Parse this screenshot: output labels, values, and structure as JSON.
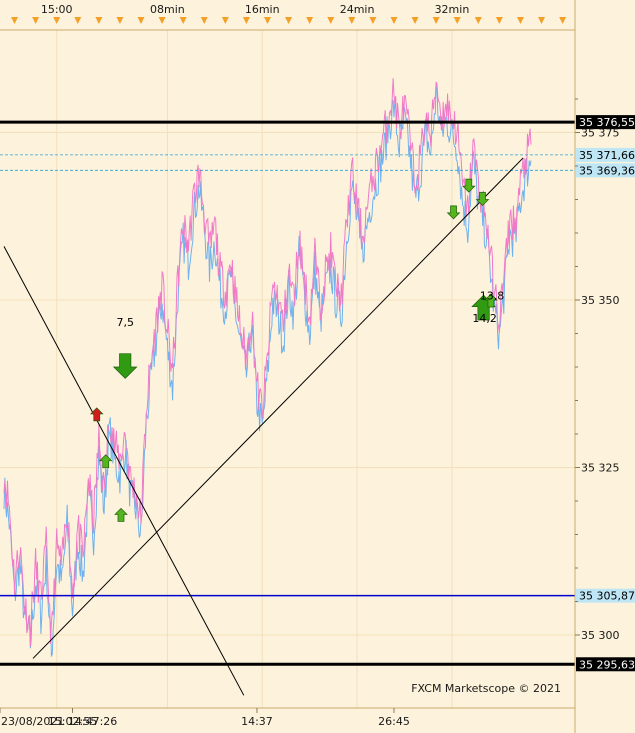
{
  "chart_data": {
    "type": "line",
    "price_axis": {
      "ticks": [
        {
          "value": 35375,
          "label": "35 375"
        },
        {
          "value": 35350,
          "label": "35 350"
        },
        {
          "value": 35325,
          "label": "35 325"
        },
        {
          "value": 35300,
          "label": "35 300"
        }
      ]
    },
    "top_time_ticks": [
      {
        "label": "15:00",
        "x": 10
      },
      {
        "label": "08min",
        "x": 31
      },
      {
        "label": "16min",
        "x": 49
      },
      {
        "label": "24min",
        "x": 67
      },
      {
        "label": "32min",
        "x": 85
      }
    ],
    "bottom_time_ticks": [
      {
        "label": "23/08/2021 14:47:26",
        "x": 0
      },
      {
        "label": "15:02:55",
        "x": 13
      },
      {
        "label": "14:37",
        "x": 48
      },
      {
        "label": "26:45",
        "x": 74
      }
    ],
    "x_range": [
      0,
      100
    ],
    "price_series": [
      [
        0,
        35323
      ],
      [
        1,
        35318
      ],
      [
        2,
        35307
      ],
      [
        3,
        35312
      ],
      [
        4,
        35303
      ],
      [
        5,
        35300
      ],
      [
        6,
        35309
      ],
      [
        7,
        35304
      ],
      [
        8,
        35312
      ],
      [
        9,
        35298
      ],
      [
        10,
        35312
      ],
      [
        11,
        35309
      ],
      [
        12,
        35318
      ],
      [
        13,
        35305
      ],
      [
        14,
        35315
      ],
      [
        15,
        35310
      ],
      [
        16,
        35322
      ],
      [
        17,
        35316
      ],
      [
        18,
        35328
      ],
      [
        19,
        35320
      ],
      [
        20,
        35332
      ],
      [
        21,
        35327
      ],
      [
        22,
        35325
      ],
      [
        23,
        35329
      ],
      [
        24,
        35322
      ],
      [
        25,
        35320
      ],
      [
        26,
        35316
      ],
      [
        27,
        35333
      ],
      [
        28,
        35340
      ],
      [
        29,
        35346
      ],
      [
        30,
        35351
      ],
      [
        31,
        35344
      ],
      [
        32,
        35338
      ],
      [
        33,
        35352
      ],
      [
        34,
        35360
      ],
      [
        35,
        35357
      ],
      [
        36,
        35364
      ],
      [
        37,
        35368
      ],
      [
        38,
        35362
      ],
      [
        39,
        35356
      ],
      [
        40,
        35360
      ],
      [
        41,
        35353
      ],
      [
        42,
        35350
      ],
      [
        43,
        35355
      ],
      [
        44,
        35349
      ],
      [
        45,
        35344
      ],
      [
        46,
        35340
      ],
      [
        47,
        35347
      ],
      [
        48,
        35336
      ],
      [
        49,
        35332
      ],
      [
        50,
        35340
      ],
      [
        51,
        35351
      ],
      [
        52,
        35349
      ],
      [
        53,
        35345
      ],
      [
        54,
        35353
      ],
      [
        55,
        35349
      ],
      [
        56,
        35358
      ],
      [
        57,
        35352
      ],
      [
        58,
        35346
      ],
      [
        59,
        35356
      ],
      [
        60,
        35348
      ],
      [
        61,
        35353
      ],
      [
        62,
        35356
      ],
      [
        63,
        35351
      ],
      [
        64,
        35349
      ],
      [
        65,
        35360
      ],
      [
        66,
        35368
      ],
      [
        67,
        35363
      ],
      [
        68,
        35358
      ],
      [
        69,
        35363
      ],
      [
        70,
        35367
      ],
      [
        71,
        35370
      ],
      [
        72,
        35373
      ],
      [
        73,
        35377
      ],
      [
        74,
        35380
      ],
      [
        75,
        35374
      ],
      [
        76,
        35378
      ],
      [
        77,
        35373
      ],
      [
        78,
        35366
      ],
      [
        79,
        35370
      ],
      [
        80,
        35376
      ],
      [
        81,
        35373
      ],
      [
        82,
        35382
      ],
      [
        83,
        35376
      ],
      [
        84,
        35378
      ],
      [
        85,
        35376
      ],
      [
        86,
        35374
      ],
      [
        87,
        35366
      ],
      [
        88,
        35362
      ],
      [
        89,
        35372
      ],
      [
        90,
        35366
      ],
      [
        91,
        35363
      ],
      [
        92,
        35358
      ],
      [
        93,
        35350
      ],
      [
        94,
        35346
      ],
      [
        95,
        35353
      ],
      [
        96,
        35361
      ],
      [
        97,
        35360
      ],
      [
        98,
        35366
      ],
      [
        99,
        35370
      ],
      [
        100,
        35372
      ]
    ],
    "horizontal_lines": [
      {
        "name": "black-upper",
        "value": 35376.55,
        "tag": "35 376,55",
        "color": "#000000",
        "tag_bg": "#000000",
        "tag_fg": "#ffffff"
      },
      {
        "name": "cyan-upper",
        "value": 35371.66,
        "tag": "35 371,66",
        "color": "#2f9ed8",
        "tag_bg": "#bfe6f5",
        "tag_fg": "#000000"
      },
      {
        "name": "cyan-lower",
        "value": 35369.36,
        "tag": "35 369,36",
        "color": "#2f9ed8",
        "tag_bg": "#bfe6f5",
        "tag_fg": "#000000"
      },
      {
        "name": "blue-level",
        "value": 35305.87,
        "tag": "35 305,87",
        "color": "#0000d0",
        "tag_bg": "#bfe6f5",
        "tag_fg": "#000000"
      },
      {
        "name": "black-lower",
        "value": 35295.63,
        "tag": "35 295,63",
        "color": "#000000",
        "tag_bg": "#000000",
        "tag_fg": "#ffffff"
      }
    ],
    "trend_lines": [
      {
        "name": "uptrend-line",
        "points": [
          [
            5.5,
            35296.5
          ],
          [
            98.5,
            35371.2
          ]
        ]
      },
      {
        "name": "downtrend-line",
        "points": [
          [
            0,
            35358
          ],
          [
            45.5,
            35291
          ]
        ]
      }
    ],
    "markers": [
      {
        "name": "sell-marker-large",
        "direction": "down",
        "color": "#2f9a12",
        "size": "large",
        "x": 23,
        "price": 35340
      },
      {
        "name": "sell-marker-red",
        "direction": "up",
        "color": "#d21c1c",
        "size": "small",
        "x": 17.6,
        "price": 35333
      },
      {
        "name": "buy-marker-1",
        "direction": "up",
        "color": "#55b51c",
        "size": "small",
        "x": 19.3,
        "price": 35326
      },
      {
        "name": "buy-marker-2",
        "direction": "up",
        "color": "#55b51c",
        "size": "small",
        "x": 22.2,
        "price": 35318
      },
      {
        "name": "sell-marker-3",
        "direction": "down",
        "color": "#55b51c",
        "size": "small",
        "x": 85.3,
        "price": 35363
      },
      {
        "name": "sell-marker-4",
        "direction": "down",
        "color": "#55b51c",
        "size": "small",
        "x": 88.2,
        "price": 35367
      },
      {
        "name": "sell-marker-5",
        "direction": "down",
        "color": "#55b51c",
        "size": "small",
        "x": 90.8,
        "price": 35365
      },
      {
        "name": "buy-marker-large",
        "direction": "up",
        "color": "#2f9a12",
        "size": "large",
        "x": 91,
        "price": 35349
      },
      {
        "name": "buy-marker-6",
        "direction": "up",
        "color": "#55b51c",
        "size": "small",
        "x": 92.4,
        "price": 35350
      }
    ],
    "annotations": [
      {
        "name": "annotation-7-5",
        "text": "7,5",
        "x": 23,
        "price": 35344
      },
      {
        "name": "annotation-13-8",
        "text": "13,8",
        "x": 92.6,
        "price": 35348
      },
      {
        "name": "annotation-14-2",
        "text": "14,2",
        "x": 91.2,
        "price": 35347
      }
    ],
    "watermark": "FXCM Marketscope © 2021",
    "colors": {
      "background": "#fdf3dc",
      "grid": "#f3e0b8",
      "ask_series": "#f07ac8",
      "bid_series": "#6fb1ee",
      "time_marker": "#f4a028"
    }
  }
}
